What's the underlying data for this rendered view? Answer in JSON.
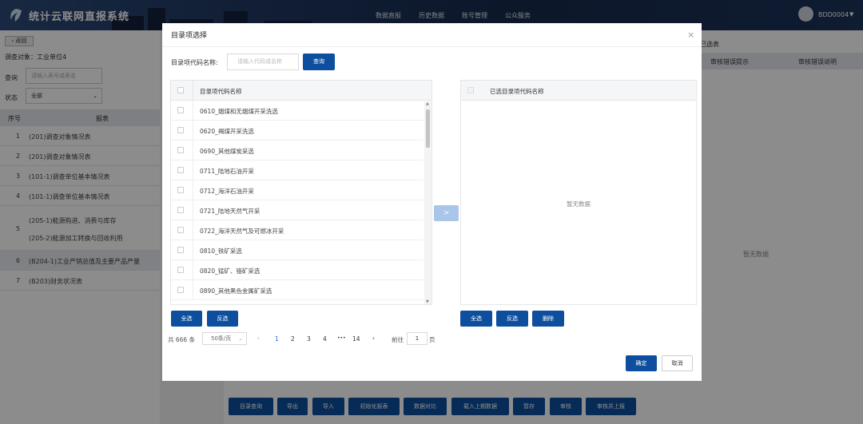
{
  "app": {
    "title": "统计云联网直报系统",
    "nav": [
      "数据直报",
      "历史数据",
      "账号管理",
      "公众服务"
    ],
    "user": "BDD0004"
  },
  "left": {
    "back_label": "返回",
    "survey_object": "调查对象：工业单位4",
    "query_label": "查询",
    "query_placeholder": "请输入表号或表名",
    "status_label": "状态",
    "status_value": "全部",
    "col_no": "序号",
    "col_report": "报表",
    "rows": [
      {
        "no": "1",
        "text": "(201)调查对象情况表"
      },
      {
        "no": "2",
        "text": "(201)调查对象情况表"
      },
      {
        "no": "3",
        "text": "(101-1)调查单位基本情况表"
      },
      {
        "no": "4",
        "text": "(101-1)调查单位基本情况表"
      },
      {
        "no": "5",
        "text": "(205-1)能源购进、消费与库存",
        "text2": "(205-2)能源加工转换与回收利用"
      },
      {
        "no": "6",
        "text": "(B204-1)工业产销总值及主要产品产量"
      },
      {
        "no": "7",
        "text": "(B203)财务状况表"
      }
    ]
  },
  "right": {
    "header": "已选表",
    "col1": "审核错误提示",
    "col2": "审核错误说明",
    "empty": "暂无数据"
  },
  "bottom_buttons": [
    "目录查询",
    "导出",
    "导入",
    "初始化报表",
    "数据对比",
    "载入上期数据",
    "暂存",
    "审核",
    "审核并上报"
  ],
  "modal": {
    "title": "目录项选择",
    "search_label": "目录项代码名称:",
    "search_placeholder": "请输入代码或名称",
    "search_button": "查询",
    "left_header": "目录项代码名称",
    "items": [
      "0610_烟煤和无烟煤开采洗选",
      "0620_褐煤开采洗选",
      "0690_其他煤炭采选",
      "0711_陆地石油开采",
      "0712_海洋石油开采",
      "0721_陆地天然气开采",
      "0722_海洋天然气及可燃冰开采",
      "0810_铁矿采选",
      "0820_锰矿、铬矿采选",
      "0890_其他黑色金属矿采选"
    ],
    "transfer_label": ">",
    "right_header": "已选目录项代码名称",
    "right_empty": "暂无数据",
    "select_all": "全选",
    "invert": "反选",
    "delete": "删除",
    "pagination": {
      "total": "共 666 条",
      "page_size": "50条/页",
      "prev": "‹",
      "pages": [
        "1",
        "2",
        "3",
        "4",
        "•••",
        "14"
      ],
      "next": "›",
      "goto_label": "前往",
      "goto_value": "1",
      "page_suffix": "页",
      "active_page": "1"
    },
    "confirm": "确定",
    "cancel": "取消"
  },
  "colors": {
    "primary": "#0d4f9e",
    "header_dark": "#1e2f54",
    "link_blue": "#1f6fd1"
  }
}
